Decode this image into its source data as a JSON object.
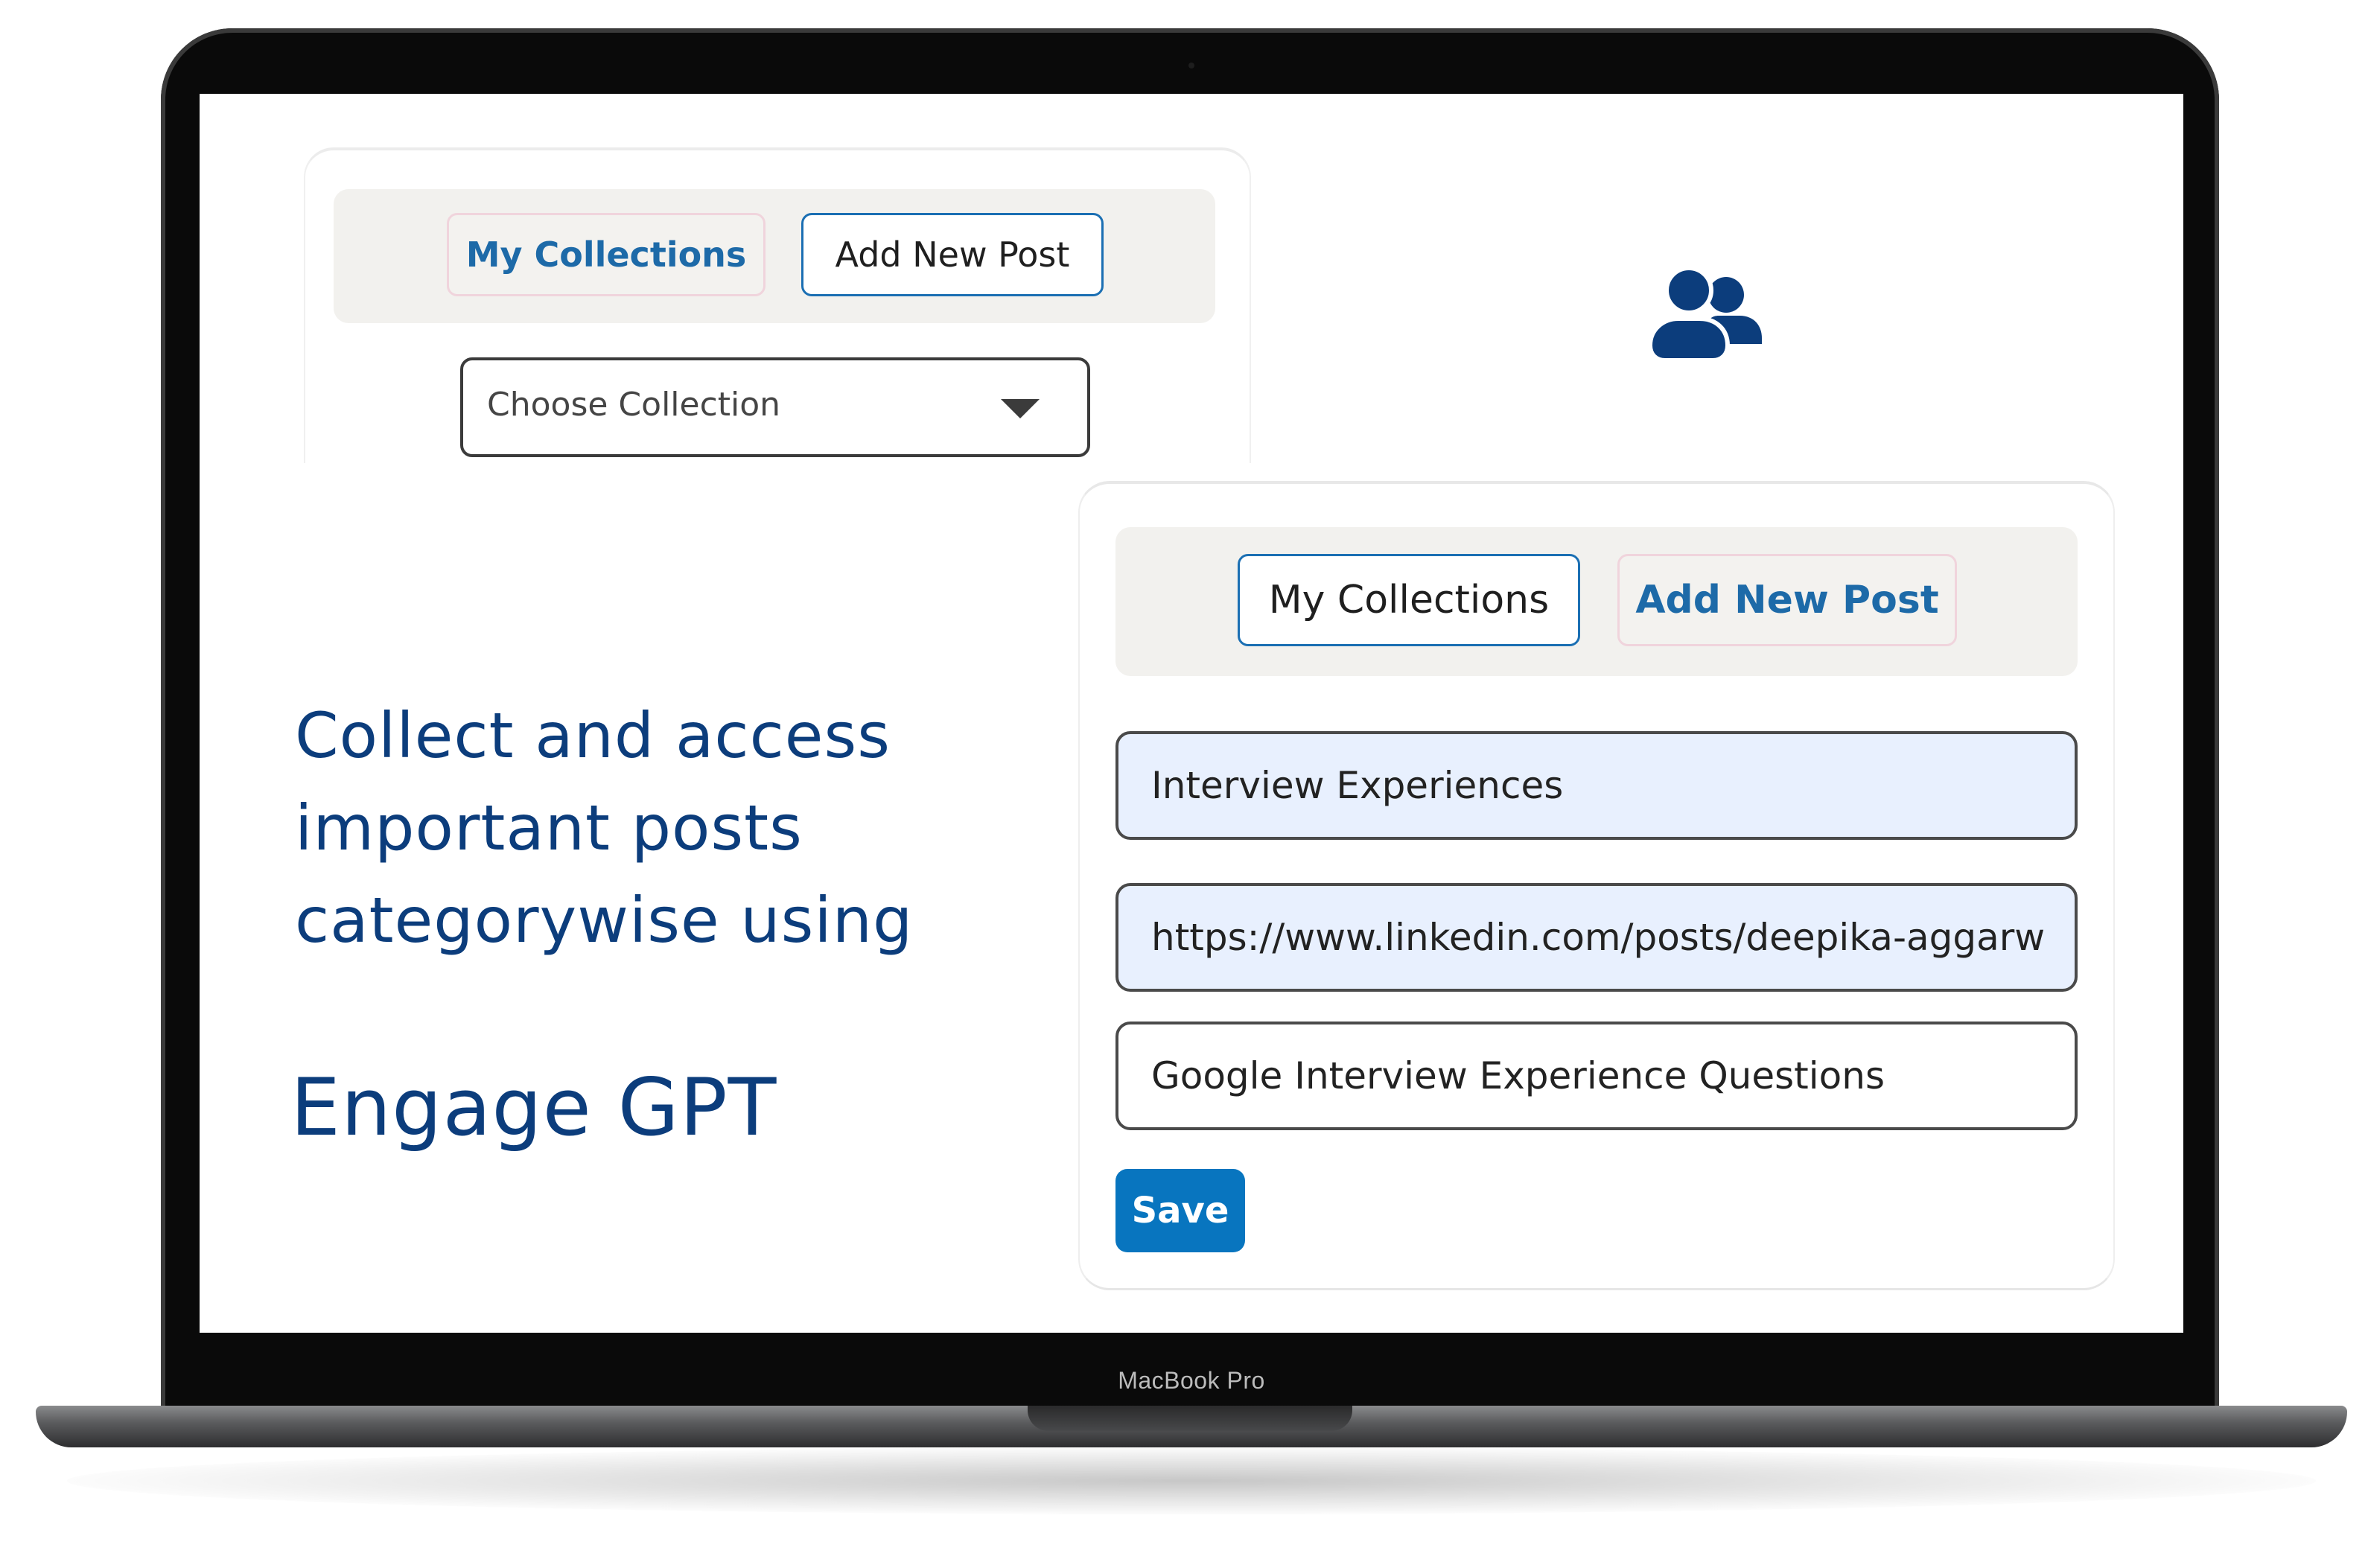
{
  "device": {
    "model_label": "MacBook Pro"
  },
  "top_panel": {
    "tabs": [
      {
        "label": "My Collections",
        "state": "inactive"
      },
      {
        "label": "Add New Post",
        "state": "active"
      }
    ],
    "select": {
      "selected_label": "Choose Collection",
      "icon": "caret-down-icon"
    }
  },
  "decorations": {
    "users_icon": "users-icon"
  },
  "headline": {
    "text": "Collect and access important posts categorywise using",
    "brand": "Engage GPT"
  },
  "bottom_panel": {
    "tabs": [
      {
        "label": "My Collections",
        "state": "active"
      },
      {
        "label": "Add New Post",
        "state": "inactive"
      }
    ],
    "fields": {
      "collection_value": "Interview Experiences",
      "url_value": "https://www.linkedin.com/posts/deepika-aggarw",
      "title_value": "Google Interview Experience Questions"
    },
    "save_label": "Save"
  },
  "colors": {
    "brand_blue": "#0c3d7c",
    "accent_blue": "#0875bf",
    "tab_link_blue": "#1d6aa8",
    "autofill_bg": "#e8f0fe",
    "panel_bg": "#f2f1ee"
  }
}
